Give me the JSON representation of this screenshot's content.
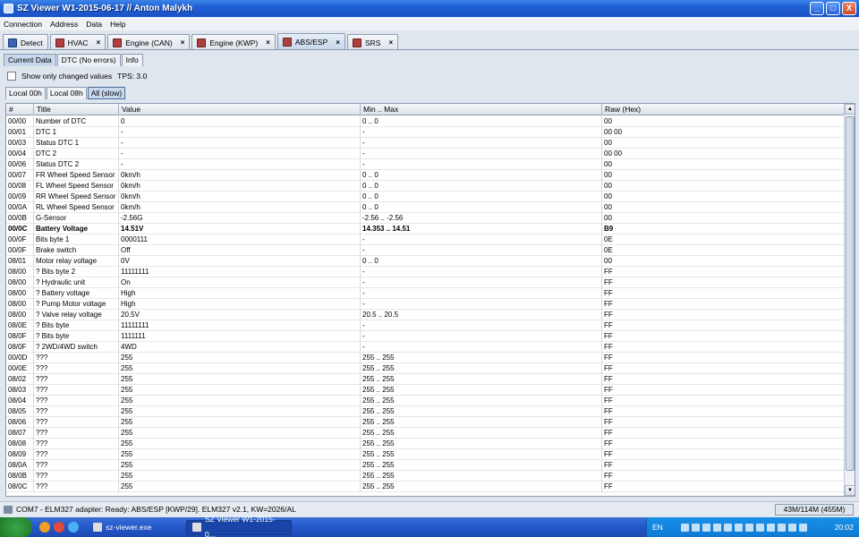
{
  "window": {
    "title": "SZ Viewer W1-2015-06-17 // Anton Malykh",
    "buttons": [
      "_",
      "□",
      "X"
    ]
  },
  "menu": [
    "Connection",
    "Address",
    "Data",
    "Help"
  ],
  "module_tabs": [
    {
      "label": "Detect",
      "closable": false,
      "active": false
    },
    {
      "label": "HVAC",
      "closable": true,
      "active": false
    },
    {
      "label": "Engine (CAN)",
      "closable": true,
      "active": false
    },
    {
      "label": "Engine (KWP)",
      "closable": true,
      "active": false
    },
    {
      "label": "ABS/ESP",
      "closable": true,
      "active": true
    },
    {
      "label": "SRS",
      "closable": true,
      "active": false
    }
  ],
  "close_glyph": "×",
  "sub_tabs": [
    "Current Data",
    "DTC (No errors)",
    "Info"
  ],
  "options": {
    "show_changed_label": "Show only changed values",
    "tps": "TPS: 3.0"
  },
  "page_tabs": [
    "Local 00h",
    "Local 08h",
    "All (slow)"
  ],
  "table": {
    "columns": [
      "#",
      "Title",
      "Value",
      "Min .. Max",
      "Raw (Hex)"
    ],
    "rows": [
      [
        "00/00",
        "Number of DTC",
        "0",
        "0 .. 0",
        "00"
      ],
      [
        "00/01",
        "DTC 1",
        "-",
        "-",
        "00 00"
      ],
      [
        "00/03",
        "Status DTC 1",
        "-",
        "-",
        "00"
      ],
      [
        "00/04",
        "DTC 2",
        "-",
        "-",
        "00 00"
      ],
      [
        "00/06",
        "Status DTC 2",
        "-",
        "-",
        "00"
      ],
      [
        "00/07",
        "FR Wheel Speed Sensor",
        "0km/h",
        "0 .. 0",
        "00"
      ],
      [
        "00/08",
        "FL Wheel Speed Sensor",
        "0km/h",
        "0 .. 0",
        "00"
      ],
      [
        "00/09",
        "RR Wheel Speed Sensor",
        "0km/h",
        "0 .. 0",
        "00"
      ],
      [
        "00/0A",
        "RL Wheel Speed Sensor",
        "0km/h",
        "0 .. 0",
        "00"
      ],
      [
        "00/0B",
        "G-Sensor",
        "-2.56G",
        "-2.56 .. -2.56",
        "00"
      ],
      [
        "00/0C",
        "Battery Voltage",
        "14.51V",
        "14.353 .. 14.51",
        "B9"
      ],
      [
        "00/0F",
        "Bits byte 1",
        "0000111",
        "-",
        "0E"
      ],
      [
        "00/0F",
        "Brake switch",
        "Off",
        "-",
        "0E"
      ],
      [
        "08/01",
        "Motor relay voltage",
        "0V",
        "0 .. 0",
        "00"
      ],
      [
        "08/00",
        "? Bits byte 2",
        "11111111",
        "-",
        "FF"
      ],
      [
        "08/00",
        "? Hydraulic unit",
        "On",
        "-",
        "FF"
      ],
      [
        "08/00",
        "? Battery voltage",
        "High",
        "-",
        "FF"
      ],
      [
        "08/00",
        "? Pump Motor voltage",
        "High",
        "-",
        "FF"
      ],
      [
        "08/00",
        "? Valve relay voltage",
        "20.5V",
        "20.5 .. 20.5",
        "FF"
      ],
      [
        "08/0E",
        "? Bits byte",
        "11111111",
        "-",
        "FF"
      ],
      [
        "08/0F",
        "? Bits byte",
        "1111111",
        "-",
        "FF"
      ],
      [
        "08/0F",
        "? 2WD/4WD switch",
        "4WD",
        "-",
        "FF"
      ],
      [
        "00/0D",
        "???",
        "255",
        "255 .. 255",
        "FF"
      ],
      [
        "00/0E",
        "???",
        "255",
        "255 .. 255",
        "FF"
      ],
      [
        "08/02",
        "???",
        "255",
        "255 .. 255",
        "FF"
      ],
      [
        "08/03",
        "???",
        "255",
        "255 .. 255",
        "FF"
      ],
      [
        "08/04",
        "???",
        "255",
        "255 .. 255",
        "FF"
      ],
      [
        "08/05",
        "???",
        "255",
        "255 .. 255",
        "FF"
      ],
      [
        "08/06",
        "???",
        "255",
        "255 .. 255",
        "FF"
      ],
      [
        "08/07",
        "???",
        "255",
        "255 .. 255",
        "FF"
      ],
      [
        "08/08",
        "???",
        "255",
        "255 .. 255",
        "FF"
      ],
      [
        "08/09",
        "???",
        "255",
        "255 .. 255",
        "FF"
      ],
      [
        "08/0A",
        "???",
        "255",
        "255 .. 255",
        "FF"
      ],
      [
        "08/0B",
        "???",
        "255",
        "255 .. 255",
        "FF"
      ],
      [
        "08/0C",
        "???",
        "255",
        "255 .. 255",
        "FF"
      ]
    ],
    "bold_row_index": 10
  },
  "status": {
    "text": "COM7 - ELM327 adapter: Ready: ABS/ESP [KWP/29]. ELM327 v2.1, KW=2026/AL",
    "memory": "43M/114M (455M)"
  },
  "taskbar": {
    "tasks": [
      "sz-viewer.exe",
      "SZ Viewer W1-2015-0..."
    ],
    "lang": "EN",
    "clock": "20:02"
  },
  "colors": {
    "titlebar": "#1f5fd6",
    "taskbar": "#2356c8",
    "tray": "#1a90e8"
  },
  "icons": [
    "app-icon",
    "detect-icon",
    "module-icon",
    "close-icon",
    "plug-icon",
    "start-icon",
    "tray-icon"
  ]
}
